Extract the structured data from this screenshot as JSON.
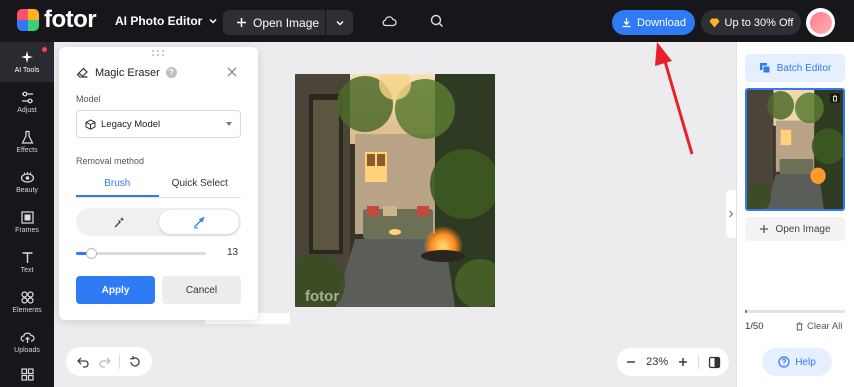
{
  "brand": {
    "name": "fotor"
  },
  "header": {
    "app_title": "AI Photo Editor",
    "open_image_label": "Open Image",
    "download_label": "Download",
    "upgrade_label": "Up to 30% Off"
  },
  "sidebar": {
    "items": [
      {
        "label": "AI Tools",
        "icon": "sparkle-icon"
      },
      {
        "label": "Adjust",
        "icon": "sliders-icon"
      },
      {
        "label": "Effects",
        "icon": "flask-icon"
      },
      {
        "label": "Beauty",
        "icon": "eye-icon"
      },
      {
        "label": "Frames",
        "icon": "frame-icon"
      },
      {
        "label": "Text",
        "icon": "text-icon"
      },
      {
        "label": "Elements",
        "icon": "shapes-icon"
      },
      {
        "label": "Uploads",
        "icon": "upload-icon"
      }
    ]
  },
  "panel": {
    "title": "Magic Eraser",
    "model_label": "Model",
    "model_value": "Legacy Model",
    "removal_label": "Removal method",
    "tabs": [
      "Brush",
      "Quick Select"
    ],
    "active_tab": "Brush",
    "brush_size": "13",
    "apply_label": "Apply",
    "cancel_label": "Cancel"
  },
  "canvas": {
    "watermark": "fotor",
    "zoom": "23%"
  },
  "right_panel": {
    "batch_label": "Batch Editor",
    "open_image_label": "Open Image",
    "count": "1/50",
    "clear_label": "Clear All",
    "help_label": "Help"
  },
  "colors": {
    "accent": "#2f7bf5",
    "topbar": "#17171b",
    "annotation_arrow": "#e8202a"
  }
}
